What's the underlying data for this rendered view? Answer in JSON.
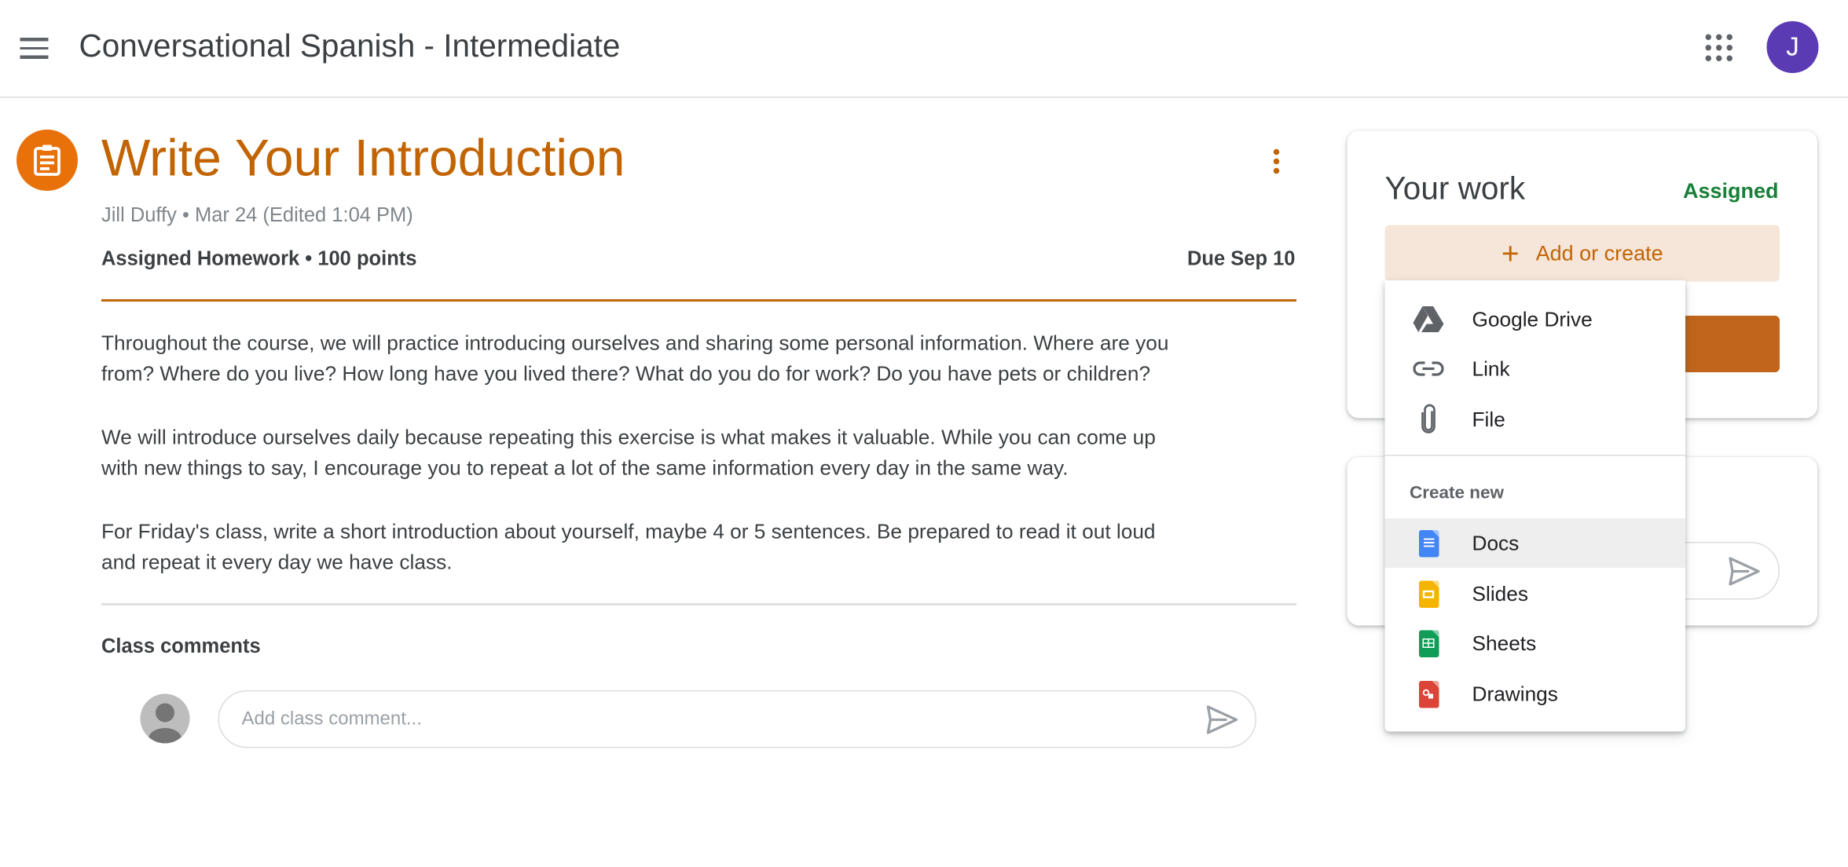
{
  "header": {
    "title": "Conversational Spanish - Intermediate",
    "avatar_letter": "J",
    "avatar_color": "#5b3bb4"
  },
  "assignment": {
    "title": "Write Your Introduction",
    "meta": "Jill Duffy • Mar 24 (Edited 1:04 PM)",
    "type_points": "Assigned Homework • 100 points",
    "due": "Due Sep 10",
    "paragraphs": [
      [
        "Throughout the course, we will practice introducing ourselves and sharing some personal information. Where are you",
        "from? Where do you live? How long have you lived there? What do you do for work? Do you have pets or children?"
      ],
      [
        "We will introduce ourselves daily because repeating this exercise is what makes it valuable. While you can come up",
        "with new things to say, I encourage you to repeat a lot of the same information every day in the same way."
      ],
      [
        "For Friday's class, write a short introduction about yourself, maybe 4 or 5 sentences. Be prepared to read it out loud",
        "and repeat it every day we have class."
      ]
    ],
    "accent_color": "#c26401"
  },
  "comments": {
    "heading": "Class comments",
    "placeholder": "Add class comment..."
  },
  "your_work": {
    "title": "Your work",
    "status": "Assigned",
    "status_color": "#188038",
    "add_label": "Add or create"
  },
  "menu": {
    "items": [
      {
        "label": "Google Drive",
        "icon": "google-drive-icon"
      },
      {
        "label": "Link",
        "icon": "link-icon"
      },
      {
        "label": "File",
        "icon": "paperclip-icon"
      }
    ],
    "create_heading": "Create new",
    "create_items": [
      {
        "label": "Docs",
        "color": "#4285f4"
      },
      {
        "label": "Slides",
        "color": "#f4b400"
      },
      {
        "label": "Sheets",
        "color": "#0f9d58"
      },
      {
        "label": "Drawings",
        "color": "#db4437"
      }
    ]
  }
}
